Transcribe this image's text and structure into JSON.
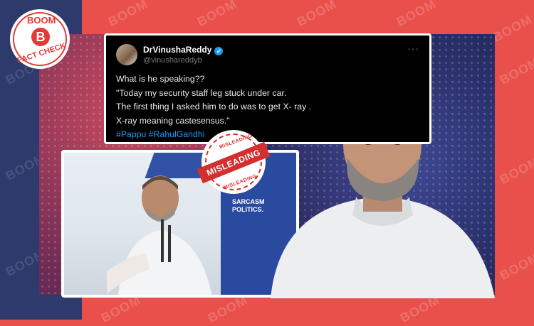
{
  "brand": {
    "logo_top": "BOOM",
    "logo_letter": "B",
    "logo_bottom": "FACT CHECK",
    "watermark": "BOOM",
    "accent": "#e9504b",
    "navy": "#2d3a6b"
  },
  "tweet": {
    "display_name": "DrVinushaReddy",
    "handle": "@vinushareddyb",
    "more_glyph": "···",
    "lines": [
      "What is he speaking??",
      "\"Today my security staff leg stuck under car.",
      "The first thing I asked him to do was to get X- ray .",
      "X-ray meaning castesensus.\""
    ],
    "hashtags": "#Pappu #RahulGandhi"
  },
  "stamp": {
    "ribbon": "MISLEADING",
    "arc_top": "MISLEADING",
    "arc_bottom": "MISLEADING"
  },
  "video": {
    "board_line1": "SARCASM",
    "board_line2": "POLITICS."
  }
}
